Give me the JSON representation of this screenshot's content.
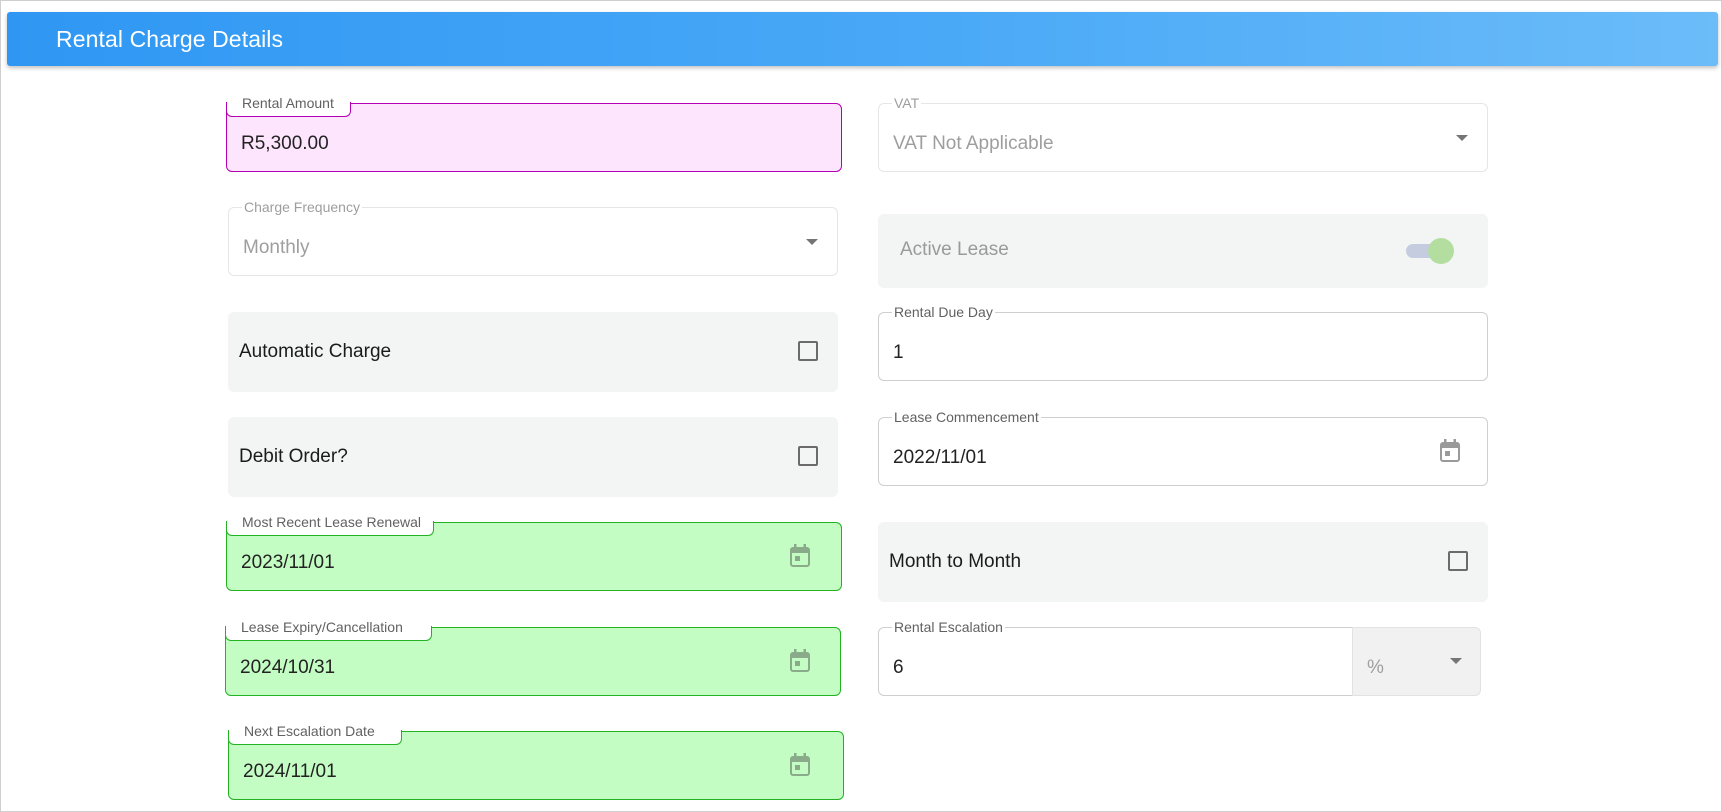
{
  "header": {
    "title": "Rental Charge Details"
  },
  "fields": {
    "rental_amount": {
      "label": "Rental Amount",
      "value": "R5,300.00"
    },
    "vat": {
      "label": "VAT",
      "value": "VAT Not Applicable"
    },
    "charge_frequency": {
      "label": "Charge Frequency",
      "value": "Monthly"
    },
    "rental_due_day": {
      "label": "Rental Due Day",
      "value": "1"
    },
    "lease_commencement": {
      "label": "Lease Commencement",
      "value": "2022/11/01"
    },
    "most_recent_renewal": {
      "label": "Most Recent Lease Renewal",
      "value": "2023/11/01"
    },
    "lease_expiry": {
      "label": "Lease Expiry/Cancellation",
      "value": "2024/10/31"
    },
    "rental_escalation": {
      "label": "Rental Escalation",
      "value": "6"
    },
    "escalation_unit": {
      "value": "%"
    },
    "next_escalation_date": {
      "label": "Next Escalation Date",
      "value": "2024/11/01"
    }
  },
  "panels": {
    "active_lease": {
      "label": "Active Lease",
      "checked": true
    },
    "automatic_charge": {
      "label": "Automatic Charge",
      "checked": false
    },
    "debit_order": {
      "label": "Debit Order?",
      "checked": false
    },
    "month_to_month": {
      "label": "Month to Month",
      "checked": false
    }
  },
  "colors": {
    "header_start": "#2f97f3",
    "header_end": "#6bbcf9",
    "pink_fill": "#fde6fd",
    "pink_border": "#b400b4",
    "green_fill": "#c4fdc4",
    "green_border": "#22b222"
  },
  "icons": [
    "calendar-icon",
    "chevron-down-icon"
  ]
}
